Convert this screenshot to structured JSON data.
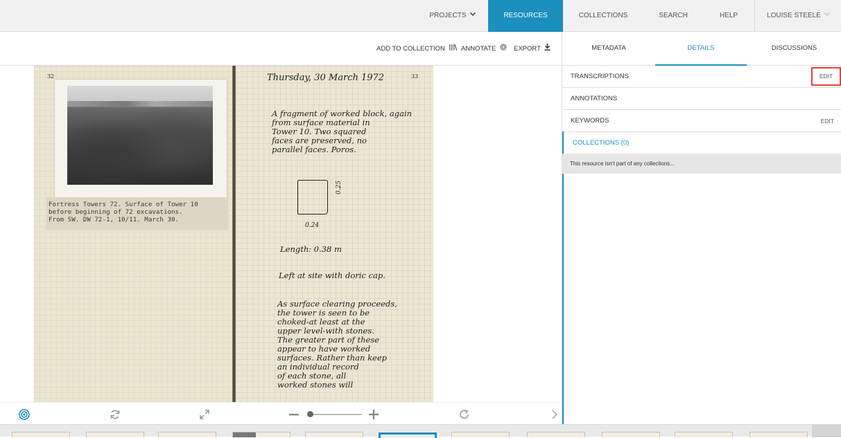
{
  "nav": {
    "projects": "PROJECTS",
    "resources": "RESOURCES",
    "collections": "COLLECTIONS",
    "search": "SEARCH",
    "help": "HELP",
    "user": "LOUISE STEELE"
  },
  "toolbar": {
    "add_to_collection": "ADD TO COLLECTION",
    "annotate": "ANNOTATE",
    "export": "EXPORT"
  },
  "document": {
    "left_page_number": "32",
    "right_page_number": "33",
    "caption": "Fortress Towers 72. Surface of Tower 10\nbefore beginning of 72 excavations.\nFrom SW. DW 72-1, 10/11. March 30.",
    "date_heading": "Thursday, 30 March 1972",
    "para1": "A fragment of worked block, again\nfrom surface material in\nTower 10. Two squared\nfaces are preserved, no\nparallel faces. Poros.",
    "dim_width": "0.24",
    "dim_height": "0.25",
    "length": "Length: 0.38 m",
    "left_at_site": "Left at site with doric cap.",
    "para2": "As surface clearing proceeds,\nthe tower is seen to be\nchoked-at least at the\nupper level-with stones.\nThe greater part of these\nappear to have worked\nsurfaces. Rather than keep\nan individual record\nof each stone, all\nworked stones will"
  },
  "panel": {
    "tabs": {
      "metadata": "METADATA",
      "details": "DETAILS",
      "discussions": "DISCUSSIONS"
    },
    "rows": {
      "transcriptions": "TRANSCRIPTIONS",
      "annotations": "ANNOTATIONS",
      "keywords": "KEYWORDS",
      "collections": "COLLECTIONS (0)",
      "edit": "EDIT"
    },
    "collections_message": "This resource isn't part of any collections..."
  },
  "icons": {
    "nav_chevron": "chevron-down-icon",
    "add_to_collection": "library-icon",
    "annotate": "target-icon",
    "export": "download-icon",
    "viewer": [
      "target-icon",
      "sync-icon",
      "expand-icon",
      "zoom-out-icon",
      "zoom-in-icon",
      "rotate-icon",
      "chevron-right-icon"
    ]
  },
  "colors": {
    "accent": "#1b8fbe",
    "highlight": "#e0423f"
  }
}
